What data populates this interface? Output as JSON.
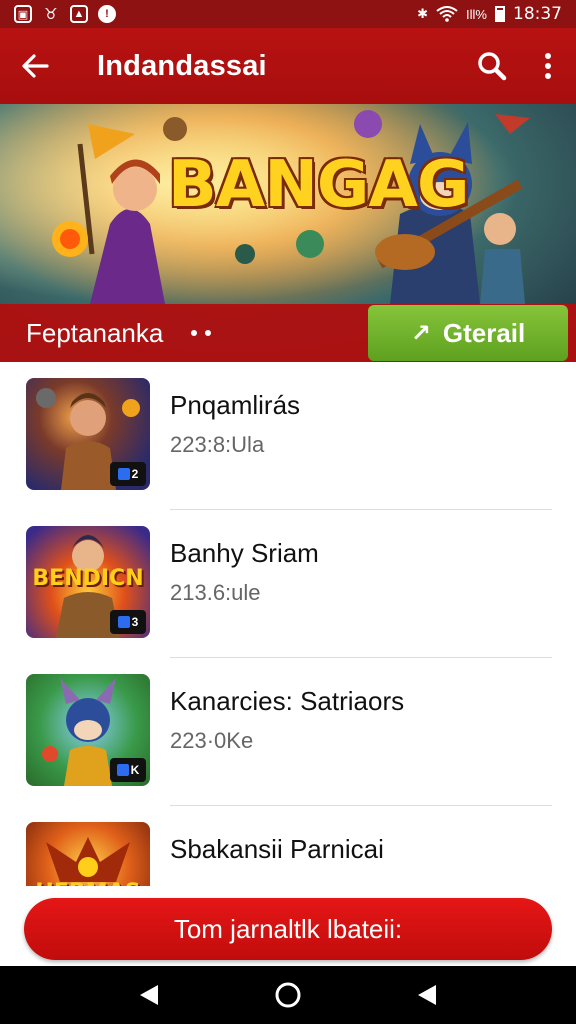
{
  "status_bar": {
    "time": "18:37",
    "signal_text": "Ill%",
    "left_icons": [
      "image-icon",
      "notification-icon",
      "photo-icon",
      "security-icon"
    ],
    "right_icons": [
      "bluetooth-icon",
      "wifi-icon",
      "signal-icon",
      "battery-icon"
    ]
  },
  "app_bar": {
    "title": "Indandassai",
    "back_icon": "back-arrow-icon",
    "search_icon": "search-icon",
    "menu_icon": "more-vert-icon"
  },
  "banner": {
    "logo_text": "BANGAG",
    "caption": "Feptananka",
    "get_button_label": "Gterail"
  },
  "list": {
    "items": [
      {
        "title": "Pnqamlirás",
        "subtitle": "223:8:Ula",
        "thumb_text": "",
        "badge": "2"
      },
      {
        "title": "Banhy Sriam",
        "subtitle": "213.6:ule",
        "thumb_text": "BENDICN",
        "badge": "3"
      },
      {
        "title": "Kanarcies: Satriaors",
        "subtitle": "223·0Ke",
        "thumb_text": "",
        "badge": "K"
      },
      {
        "title": "Sbakansii Parnicai",
        "subtitle": "",
        "thumb_text": "HERMAS",
        "badge": ""
      }
    ]
  },
  "cta": {
    "label": "Tom jarnaltlk lbateii:"
  },
  "colors": {
    "primary": "#b81212",
    "status_bar": "#8e1212",
    "accent_green": "#6fb02a",
    "cta_red": "#d91010"
  }
}
